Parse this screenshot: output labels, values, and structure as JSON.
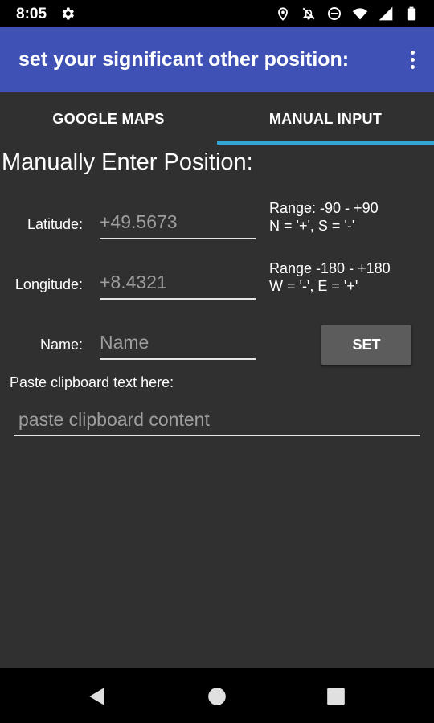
{
  "status_bar": {
    "time": "8:05",
    "left_icon": "settings-gear-icon",
    "right_icons": [
      "location-icon",
      "notifications-off-icon",
      "do-not-disturb-icon",
      "wifi-icon",
      "signal-icon",
      "battery-icon"
    ]
  },
  "app_bar": {
    "title": "set your significant other position:",
    "menu_icon": "overflow-menu-icon",
    "background": "#3f51b5"
  },
  "tabs": [
    {
      "label": "GOOGLE MAPS",
      "selected": false
    },
    {
      "label": "MANUAL INPUT",
      "selected": true
    }
  ],
  "tab_indicator_color": "#33a6d6",
  "section_title": "Manually Enter Position:",
  "form": {
    "latitude": {
      "label": "Latitude:",
      "placeholder": "+49.5673",
      "hint_line1": "Range: -90 - +90",
      "hint_line2": "N = '+',  S = '-'"
    },
    "longitude": {
      "label": "Longitude:",
      "placeholder": "+8.4321",
      "hint_line1": "Range -180 - +180",
      "hint_line2": "W = '-', E = '+'"
    },
    "name": {
      "label": "Name:",
      "placeholder": "Name"
    },
    "set_button": "SET",
    "paste_label": "Paste clipboard text here:",
    "paste_placeholder": "paste clipboard content"
  },
  "nav_bar": {
    "back_icon": "back-triangle-icon",
    "home_icon": "home-circle-icon",
    "recents_icon": "recents-square-icon"
  }
}
